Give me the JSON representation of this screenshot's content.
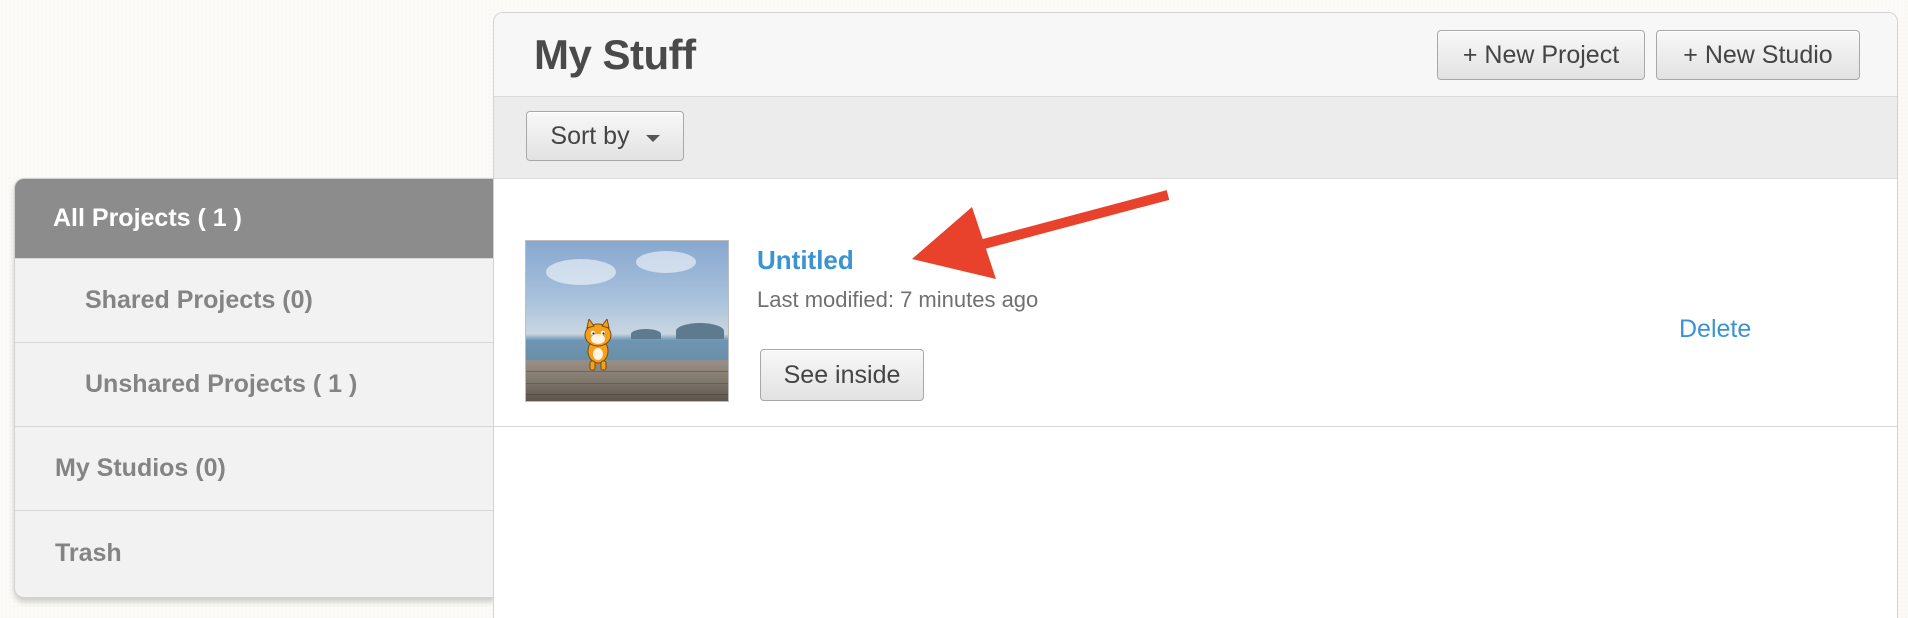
{
  "sidebar": {
    "items": [
      {
        "label": "All Projects ( 1 )",
        "active": true
      },
      {
        "label": "Shared Projects (0)",
        "active": false
      },
      {
        "label": "Unshared Projects ( 1 )",
        "active": false
      },
      {
        "label": "My Studios (0)",
        "active": false
      },
      {
        "label": "Trash",
        "active": false
      }
    ]
  },
  "header": {
    "title": "My Stuff",
    "new_project_label": "+ New Project",
    "new_studio_label": "+ New Studio"
  },
  "toolbar": {
    "sort_label": "Sort by"
  },
  "projects": [
    {
      "title": "Untitled",
      "modified": "Last modified: 7 minutes ago",
      "see_inside_label": "See inside",
      "delete_label": "Delete",
      "thumbnail_icon": "scratch-cat-beach-thumbnail"
    }
  ],
  "colors": {
    "accent_link": "#3b94d1",
    "active_nav": "#8c8c8c",
    "annotation_arrow": "#e8422c"
  }
}
